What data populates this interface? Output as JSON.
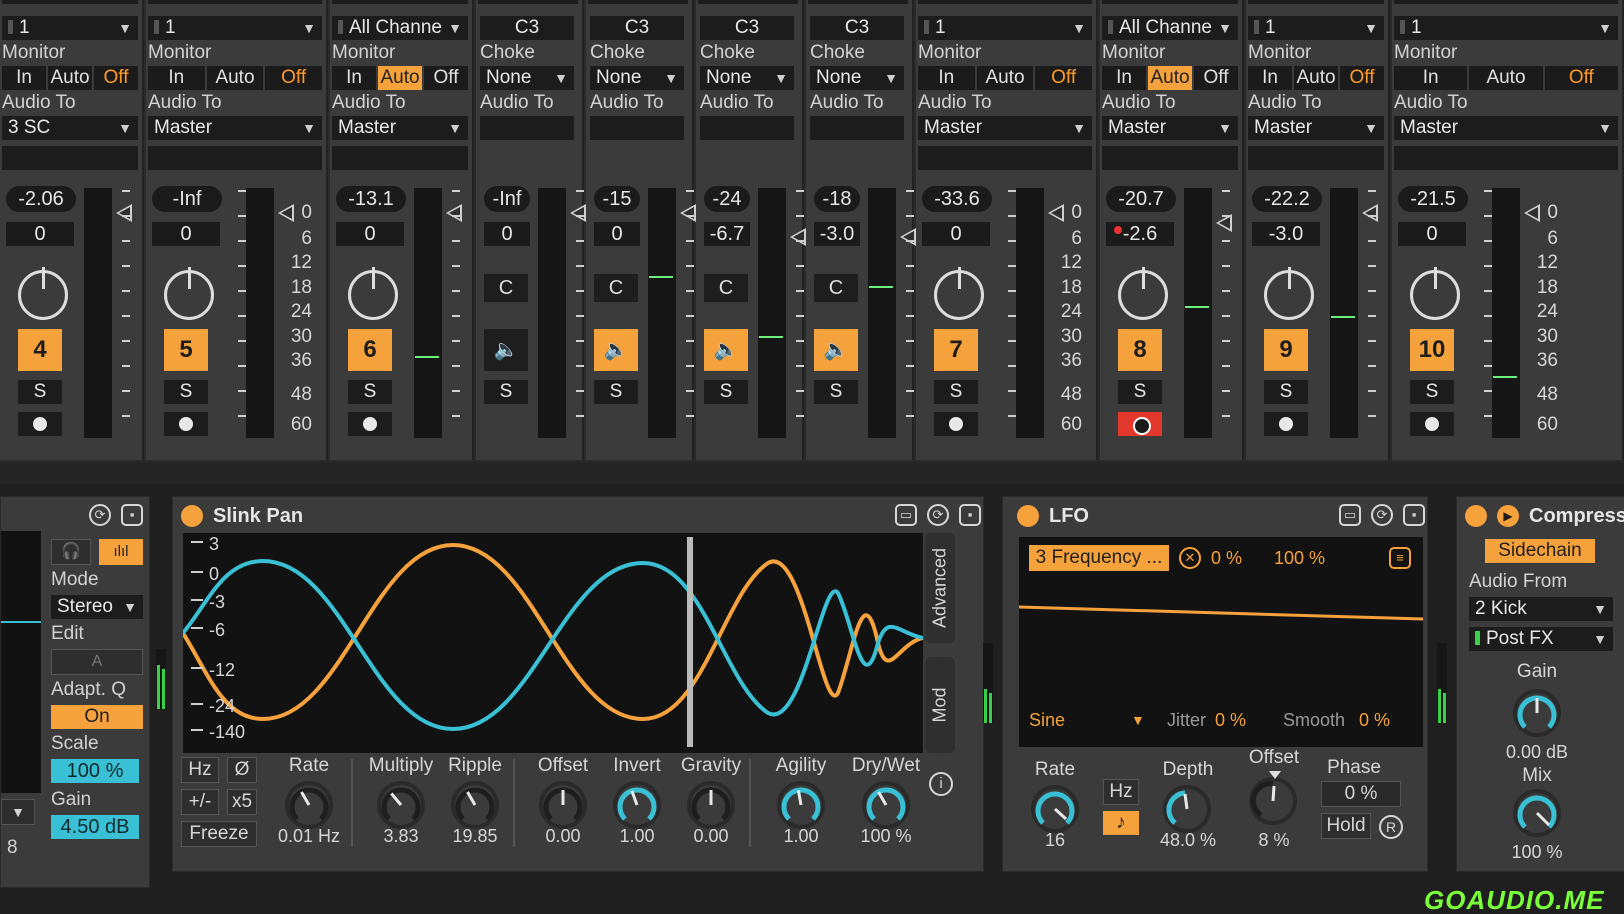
{
  "mixer": {
    "monitor_label": "Monitor",
    "audio_to_label": "Audio To",
    "choke_label": "Choke",
    "in_label": "In",
    "auto_label": "Auto",
    "off_label": "Off",
    "solo_label": "S",
    "clip_label": "C",
    "scale": [
      "0",
      "6",
      "12",
      "18",
      "24",
      "30",
      "36",
      "48",
      "60"
    ],
    "strips": [
      {
        "input": "1",
        "audio_to": "3 SC",
        "vol": "-2.06",
        "pan": "0",
        "num": "4",
        "mon": "off"
      },
      {
        "input": "1",
        "audio_to": "Master",
        "vol": "-Inf",
        "pan": "0",
        "num": "5",
        "mon": "off"
      },
      {
        "input": "All Channe",
        "audio_to": "Master",
        "vol": "-13.1",
        "pan": "0",
        "num": "6",
        "mon": "auto"
      },
      {
        "note": "C3",
        "choke": "",
        "vol": "-Inf",
        "pan": "0"
      },
      {
        "note": "C3",
        "choke": "None",
        "vol": "-15",
        "pan": "0"
      },
      {
        "note": "C3",
        "choke": "None",
        "vol": "-24",
        "pan": "-6.7"
      },
      {
        "note": "C3",
        "choke": "None",
        "vol": "-18",
        "pan": "-3.0"
      },
      {
        "input": "1",
        "audio_to": "Master",
        "vol": "-33.6",
        "pan": "0",
        "num": "7",
        "mon": "off"
      },
      {
        "input": "All Channe",
        "audio_to": "Master",
        "vol": "-20.7",
        "pan": "-2.6",
        "num": "8",
        "mon": "auto"
      },
      {
        "input": "1",
        "audio_to": "Master",
        "vol": "-22.2",
        "pan": "-3.0",
        "num": "9",
        "mon": "off"
      },
      {
        "input": "1",
        "audio_to": "Master",
        "vol": "-21.5",
        "pan": "0",
        "num": "10",
        "mon": "off"
      }
    ],
    "choke_options": [
      "None",
      "None",
      "None",
      "None"
    ]
  },
  "eq": {
    "mode_label": "Mode",
    "mode_value": "Stereo",
    "edit_label": "Edit",
    "edit_value": "A",
    "adaptq_label": "Adapt. Q",
    "adaptq_value": "On",
    "scale_label": "Scale",
    "scale_value": "100 %",
    "gain_label": "Gain",
    "gain_value": "4.50 dB",
    "left_num": "8"
  },
  "slink": {
    "title": "Slink Pan",
    "y_labels": [
      "3",
      "0",
      "-3",
      "-6",
      "-12",
      "-24",
      "-140"
    ],
    "advanced_tab": "Advanced",
    "mod_tab": "Mod",
    "hz_btn": "Hz",
    "phase_btn": "Ø",
    "plusminus_btn": "+/-",
    "x5_btn": "x5",
    "freeze_btn": "Freeze",
    "info": "i",
    "params": [
      {
        "label": "Rate",
        "value": "0.01 Hz"
      },
      {
        "label": "Multiply",
        "value": "3.83"
      },
      {
        "label": "Ripple",
        "value": "19.85"
      },
      {
        "label": "Offset",
        "value": "0.00"
      },
      {
        "label": "Invert",
        "value": "1.00"
      },
      {
        "label": "Gravity",
        "value": "0.00"
      },
      {
        "label": "Agility",
        "value": "1.00"
      },
      {
        "label": "Dry/Wet",
        "value": "100 %"
      }
    ]
  },
  "lfo": {
    "title": "LFO",
    "map_target": "3 Frequency ...",
    "min": "0 %",
    "max": "100 %",
    "wave": "Sine",
    "jitter_label": "Jitter",
    "jitter_value": "0 %",
    "smooth_label": "Smooth",
    "smooth_value": "0 %",
    "rate_label": "Rate",
    "rate_value": "16",
    "hz_btn": "Hz",
    "depth_label": "Depth",
    "depth_value": "48.0 %",
    "offset_label": "Offset",
    "offset_value": "8 %",
    "phase_label": "Phase",
    "phase_value": "0 %",
    "hold_btn": "Hold",
    "r_btn": "R"
  },
  "compressor": {
    "title": "Compress",
    "sidechain_btn": "Sidechain",
    "audio_from_label": "Audio From",
    "audio_from_value": "2 Kick",
    "tap_value": "Post FX",
    "gain_label": "Gain",
    "gain_value": "0.00 dB",
    "mix_label": "Mix",
    "mix_value": "100 %"
  },
  "watermark": "GOAUDIO.ME",
  "colors": {
    "accent": "#f6a23c",
    "cyan": "#3ac0d5",
    "meter": "#39d14a"
  }
}
